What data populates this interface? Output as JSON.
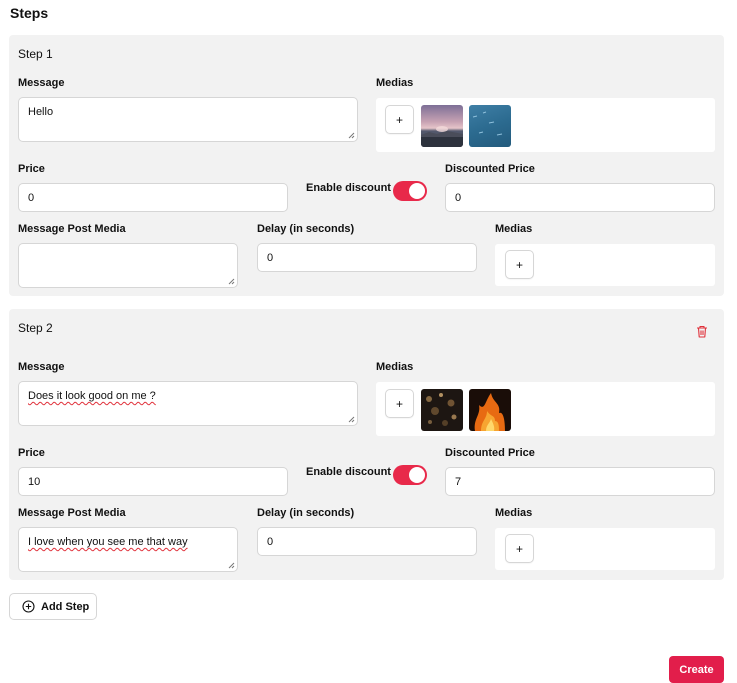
{
  "page_title": "Steps",
  "steps": [
    {
      "title": "Step 1",
      "message_label": "Message",
      "message_value": "Hello",
      "medias_label": "Medias",
      "price_label": "Price",
      "price_value": "0",
      "enable_discount_label": "Enable discount",
      "enable_discount_on": true,
      "discounted_price_label": "Discounted Price",
      "discounted_price_value": "0",
      "post_media_label": "Message Post Media",
      "post_media_value": "",
      "delay_label": "Delay (in seconds)",
      "delay_value": "0",
      "post_medias_label": "Medias",
      "add_media_label": "+",
      "thumbnails": [
        "sunset-over-water-photo",
        "blue-water-photo"
      ]
    },
    {
      "title": "Step 2",
      "message_label": "Message",
      "message_value": "Does it look good on me ?",
      "medias_label": "Medias",
      "price_label": "Price",
      "price_value": "10",
      "enable_discount_label": "Enable discount",
      "enable_discount_on": true,
      "discounted_price_label": "Discounted Price",
      "discounted_price_value": "7",
      "post_media_label": "Message Post Media",
      "post_media_value": "I love when you see me that way",
      "delay_label": "Delay (in seconds)",
      "delay_value": "0",
      "post_medias_label": "Medias",
      "add_media_label": "+",
      "thumbnails": [
        "bokeh-lights-photo",
        "fire-photo"
      ],
      "delete_icon": "trash-icon"
    }
  ],
  "add_step_label": "Add Step",
  "create_label": "Create",
  "colors": {
    "accent": "#e8294a",
    "create_button": "#e21e4b",
    "panel_bg": "#f2f2f2",
    "trash": "#e0303a"
  }
}
